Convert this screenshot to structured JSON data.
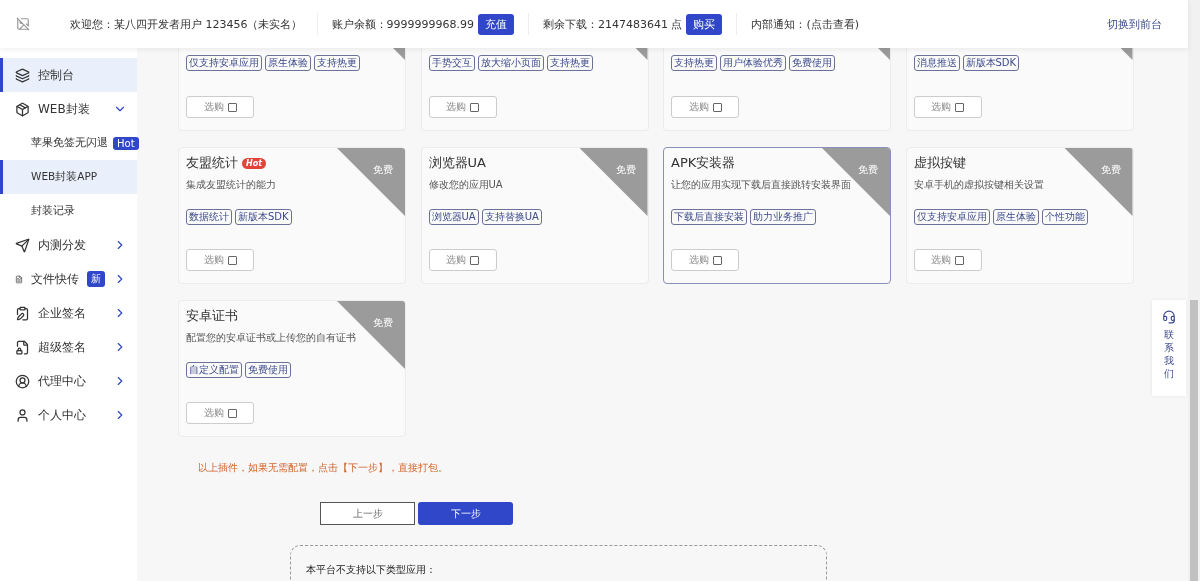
{
  "header": {
    "welcome": "欢迎您：某八四开发者用户 123456（未实名）",
    "balance": "账户余额：9999999968.99",
    "recharge_button": "充值",
    "downloads": "剩余下载：2147483641 点",
    "buy_button": "购买",
    "notice": "内部通知：(点击查看)",
    "switch_link": "切换到前台"
  },
  "sidebar": {
    "items": [
      {
        "label": "控制台",
        "selected": true
      },
      {
        "label": "WEB封装",
        "selected": false,
        "expanded": true,
        "children": [
          {
            "label": "苹果免签无闪退",
            "badge": "Hot",
            "selected": false
          },
          {
            "label": "WEB封装APP",
            "selected": true
          },
          {
            "label": "封装记录",
            "selected": false
          }
        ]
      },
      {
        "label": "内测分发",
        "selected": false,
        "expanded": false
      },
      {
        "label": "文件快传",
        "badge": "新",
        "selected": false,
        "expanded": false
      },
      {
        "label": "企业签名",
        "selected": false,
        "expanded": false
      },
      {
        "label": "超级签名",
        "selected": false,
        "expanded": false
      },
      {
        "label": "代理中心",
        "selected": false,
        "expanded": false
      },
      {
        "label": "个人中心",
        "selected": false,
        "expanded": false
      }
    ]
  },
  "plugins": [
    {
      "kind": "partial",
      "tags": [
        "仅支持安卓应用",
        "原生体验",
        "支持热更"
      ],
      "buy_label": "选购",
      "checked": false,
      "selected": false
    },
    {
      "kind": "partial",
      "tags": [
        "手势交互",
        "放大缩小页面",
        "支持热更"
      ],
      "buy_label": "选购",
      "checked": false,
      "selected": false
    },
    {
      "kind": "partial",
      "tags": [
        "支持热更",
        "用户体验优秀",
        "免费使用"
      ],
      "buy_label": "选购",
      "checked": false,
      "selected": false
    },
    {
      "kind": "partial",
      "tags": [
        "消息推送",
        "新版本SDK"
      ],
      "buy_label": "选购",
      "checked": false,
      "selected": false
    },
    {
      "kind": "full",
      "title": "友盟统计",
      "badge": "Hot",
      "ribbon": "免费",
      "description": "集成友盟统计的能力",
      "tags": [
        "数据统计",
        "新版本SDK"
      ],
      "buy_label": "选购",
      "checked": false,
      "selected": false
    },
    {
      "kind": "full",
      "title": "浏览器UA",
      "ribbon": "免费",
      "description": "修改您的应用UA",
      "tags": [
        "浏览器UA",
        "支持替换UA"
      ],
      "buy_label": "选购",
      "checked": false,
      "selected": false
    },
    {
      "kind": "full",
      "title": "APK安装器",
      "ribbon": "免费",
      "description": "让您的应用实现下载后直接跳转安装界面",
      "tags": [
        "下载后直接安装",
        "助力业务推广"
      ],
      "buy_label": "选购",
      "checked": false,
      "selected": true
    },
    {
      "kind": "full",
      "title": "虚拟按键",
      "ribbon": "免费",
      "description": "安卓手机的虚拟按键相关设置",
      "tags": [
        "仅支持安卓应用",
        "原生体验",
        "个性功能"
      ],
      "buy_label": "选购",
      "checked": false,
      "selected": false
    },
    {
      "kind": "full",
      "title": "安卓证书",
      "ribbon": "免费",
      "description": "配置您的安卓证书或上传您的自有证书",
      "tags": [
        "自定义配置",
        "免费使用"
      ],
      "buy_label": "选购",
      "checked": false,
      "selected": false
    }
  ],
  "note": "以上插件，如果无需配置，点击【下一步】，直接打包。",
  "prev_button": "上一步",
  "next_button": "下一步",
  "unsupported_box": {
    "title": "本平台不支持以下类型应用："
  },
  "contact": "联系我们"
}
